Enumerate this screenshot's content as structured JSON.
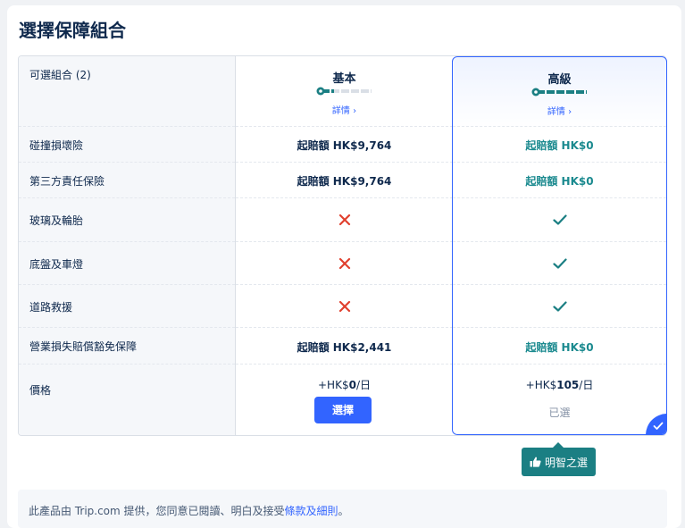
{
  "title": "選擇保障組合",
  "labels": {
    "header": "可選組合 (2)",
    "collision": "碰撞損壞險",
    "third_party": "第三方責任保險",
    "glass_tires": "玻璃及輪胎",
    "undercarriage": "底盤及車燈",
    "roadside": "道路救援",
    "loss_of_use": "營業損失賠償豁免保障",
    "price": "價格"
  },
  "plans": [
    {
      "name": "基本",
      "details": "詳情 ›",
      "collision": "起賠額 HK$9,764",
      "third_party": "起賠額 HK$9,764",
      "glass_tires": "cross",
      "undercarriage": "cross",
      "roadside": "cross",
      "loss_of_use": "起賠額 HK$2,441",
      "price_prefix": "+HK$",
      "price_amount": "0",
      "price_unit": "/日",
      "action": "選擇",
      "level": 0.2
    },
    {
      "name": "高級",
      "details": "詳情 ›",
      "collision": "起賠額 HK$0",
      "third_party": "起賠額 HK$0",
      "glass_tires": "check",
      "undercarriage": "check",
      "roadside": "check",
      "loss_of_use": "起賠額 HK$0",
      "price_prefix": "+HK$",
      "price_amount": "105",
      "price_unit": "/日",
      "status": "已選",
      "level": 1.0
    }
  ],
  "badge": {
    "icon": "thumbs-up-icon",
    "label": "明智之選"
  },
  "footer": {
    "text": "此產品由 Trip.com 提供，您同意已閱讀、明白及接受",
    "link": "條款及細則",
    "end": "。"
  },
  "colors": {
    "accent": "#3264ff",
    "teal": "#1b8a8f",
    "cross": "#e0402e",
    "text": "#0f294d"
  }
}
